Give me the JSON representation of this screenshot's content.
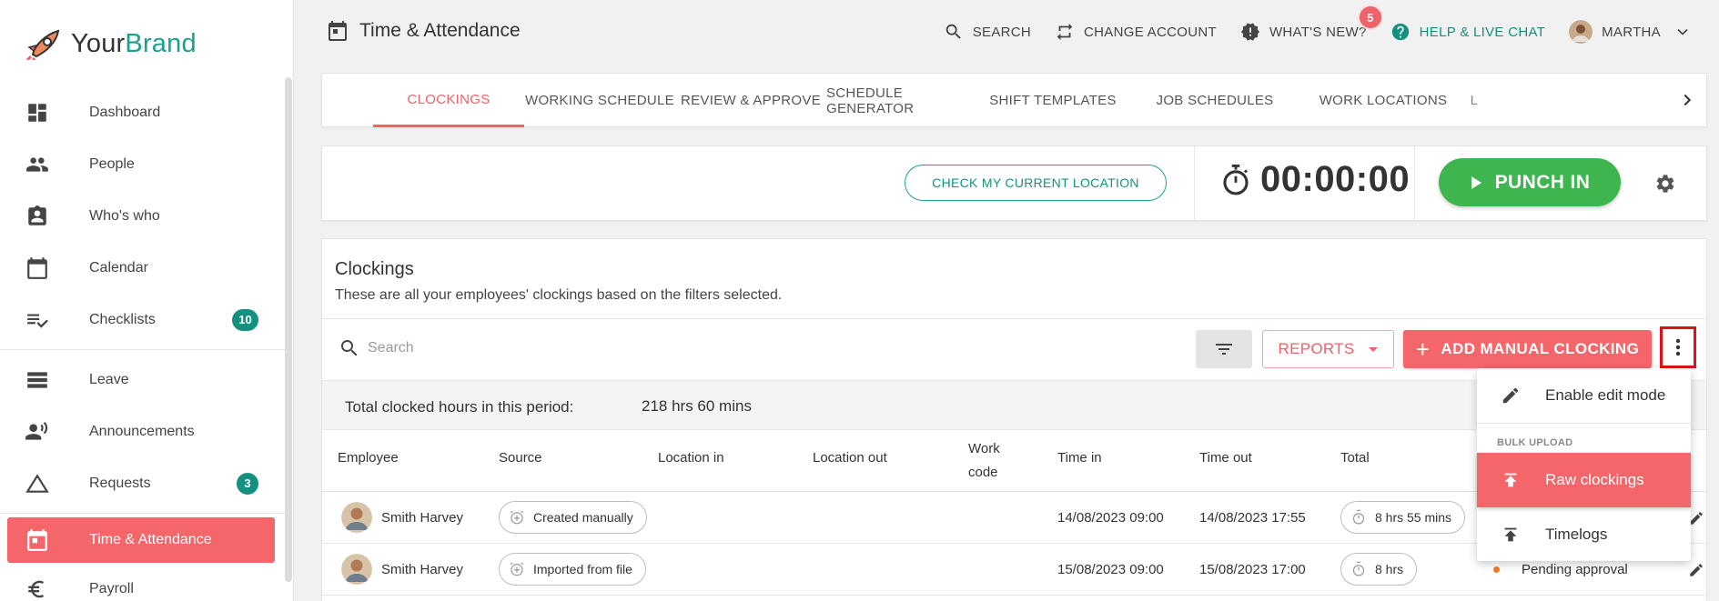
{
  "brand": {
    "part1": "Your",
    "part2": "Brand"
  },
  "colors": {
    "accent": "#f4666a",
    "teal": "#14907f",
    "green": "#3fb54f",
    "pending": "#f07c1d"
  },
  "sidebar": {
    "items": [
      {
        "label": "Dashboard",
        "icon": "dashboard-icon"
      },
      {
        "label": "People",
        "icon": "people-icon"
      },
      {
        "label": "Who's who",
        "icon": "contact-card-icon"
      },
      {
        "label": "Calendar",
        "icon": "calendar-icon"
      },
      {
        "label": "Checklists",
        "icon": "checklist-icon",
        "badge": "10"
      },
      {
        "label": "Leave",
        "icon": "leave-icon"
      },
      {
        "label": "Announcements",
        "icon": "megaphone-icon"
      },
      {
        "label": "Requests",
        "icon": "triangle-icon",
        "badge": "3"
      },
      {
        "label": "Time & Attendance",
        "icon": "calendar-today-icon",
        "active": true
      },
      {
        "label": "Payroll",
        "icon": "euro-icon"
      }
    ]
  },
  "header": {
    "title": "Time & Attendance",
    "search": "SEARCH",
    "change_account": "CHANGE ACCOUNT",
    "whats_new": "WHAT'S NEW?",
    "whats_new_count": "5",
    "help": "HELP & LIVE CHAT",
    "user": "MARTHA"
  },
  "tabs": [
    {
      "label": "CLOCKINGS",
      "active": true
    },
    {
      "label": "WORKING SCHEDULE"
    },
    {
      "label": "REVIEW & APPROVE"
    },
    {
      "label": "SCHEDULE GENERATOR"
    },
    {
      "label": "SHIFT TEMPLATES"
    },
    {
      "label": "JOB SCHEDULES"
    },
    {
      "label": "WORK LOCATIONS"
    },
    {
      "label": "L"
    }
  ],
  "punch": {
    "check_location": "CHECK MY CURRENT LOCATION",
    "timer": "00:00:00",
    "punch_in": "PUNCH IN"
  },
  "clockings": {
    "title": "Clockings",
    "subtitle": "These are all your employees' clockings based on the filters selected.",
    "search_placeholder": "Search",
    "reports": "REPORTS",
    "add_manual": "ADD MANUAL CLOCKING",
    "total_label": "Total clocked hours in this period:",
    "total_value": "218 hrs 60 mins",
    "columns": {
      "employee": "Employee",
      "source": "Source",
      "location_in": "Location in",
      "location_out": "Location out",
      "work_code_1": "Work",
      "work_code_2": "code",
      "time_in": "Time in",
      "time_out": "Time out",
      "total": "Total"
    },
    "rows": [
      {
        "employee": "Smith Harvey",
        "source": "Created manually",
        "time_in": "14/08/2023 09:00",
        "time_out": "14/08/2023 17:55",
        "total": "8 hrs 55 mins",
        "status": ""
      },
      {
        "employee": "Smith Harvey",
        "source": "Imported from file",
        "time_in": "15/08/2023 09:00",
        "time_out": "15/08/2023 17:00",
        "total": "8 hrs",
        "status": "Pending approval"
      }
    ]
  },
  "menu": {
    "enable_edit": "Enable edit mode",
    "section": "BULK UPLOAD",
    "raw_clockings": "Raw clockings",
    "timelogs": "Timelogs"
  }
}
